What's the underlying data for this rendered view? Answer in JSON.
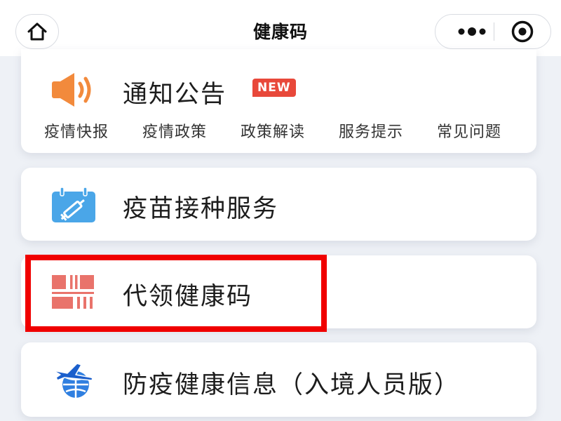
{
  "nav": {
    "title": "健康码"
  },
  "notice": {
    "title": "通知公告",
    "badge": "NEW",
    "links": [
      "疫情快报",
      "疫情政策",
      "政策解读",
      "服务提示",
      "常见问题"
    ]
  },
  "services": {
    "vaccine": "疫苗接种服务",
    "proxy_code": "代领健康码",
    "entry_info": "防疫健康信息（入境人员版）"
  },
  "colors": {
    "accent_orange": "#f28a3c",
    "badge_red": "#e8483a",
    "vaccine_blue": "#4aa6e8",
    "proxy_red": "#e9736b",
    "highlight_red": "#f00000"
  },
  "icons": {
    "home": "home-icon",
    "more": "more-dots-icon",
    "target": "target-icon",
    "notice": "speaker-icon",
    "vaccine": "calendar-syringe-icon",
    "proxy": "qr-code-icon",
    "entry": "plane-globe-icon"
  }
}
